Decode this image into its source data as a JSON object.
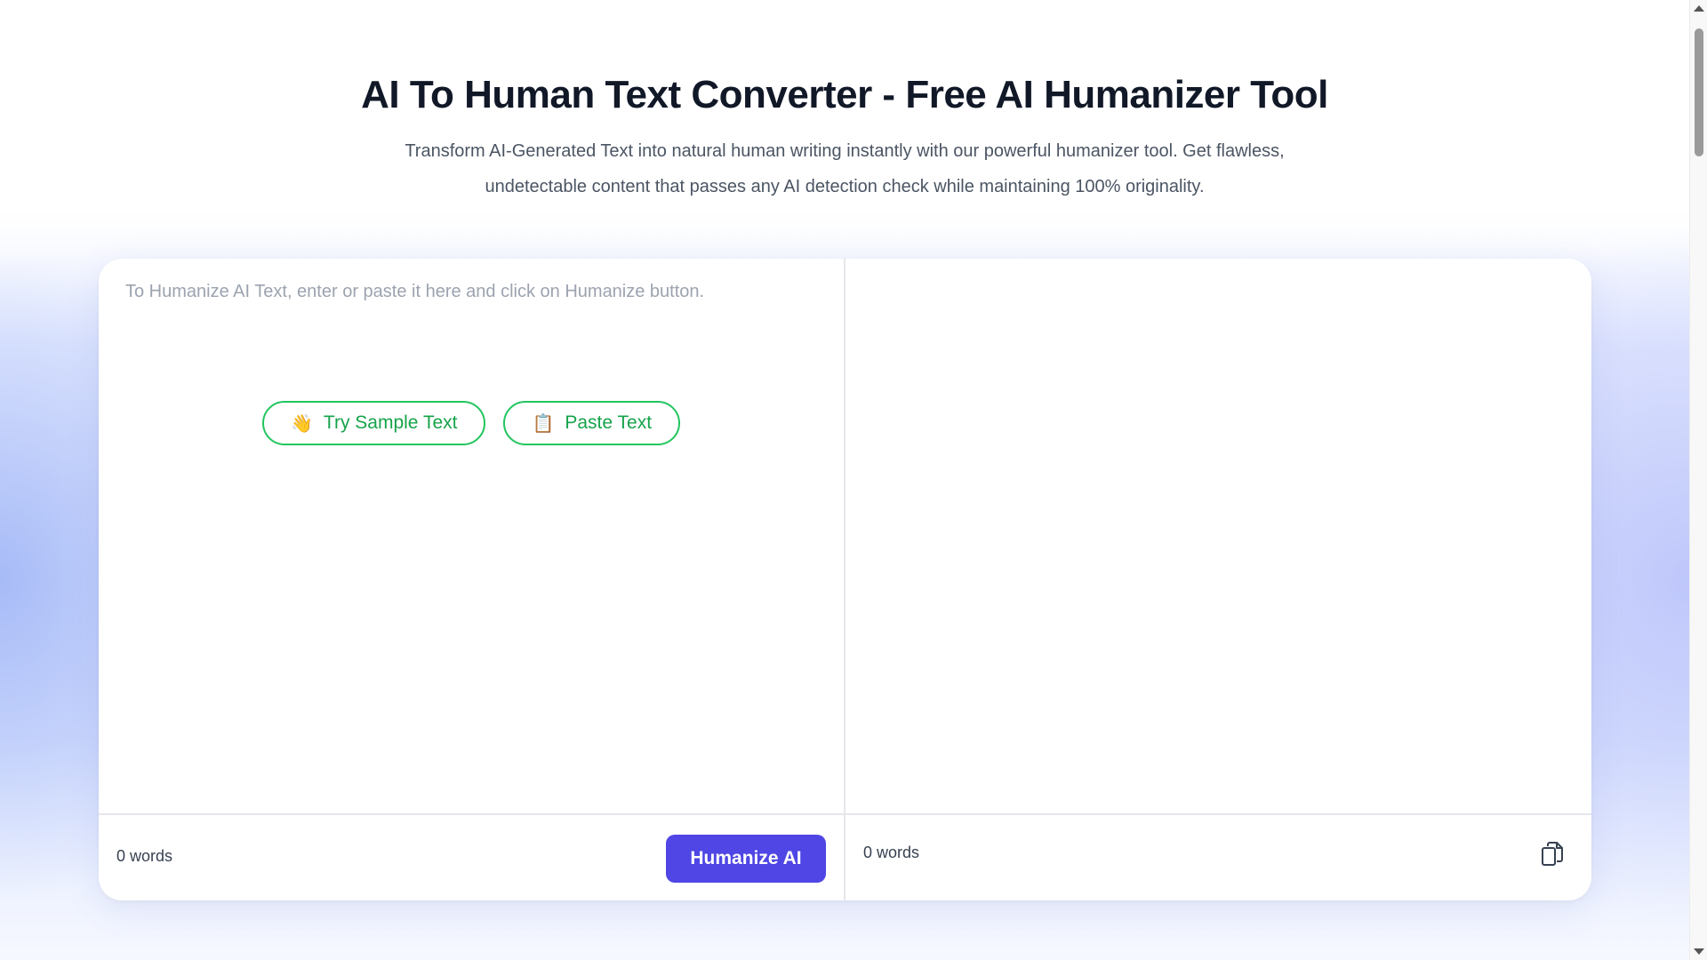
{
  "hero": {
    "title": "AI To Human Text Converter - Free AI Humanizer Tool",
    "subtitle": "Transform AI-Generated Text into natural human writing instantly with our powerful humanizer tool. Get flawless, undetectable content that passes any AI detection check while maintaining 100% originality."
  },
  "input_pane": {
    "placeholder": "To Humanize AI Text, enter or paste it here and click on Humanize button.",
    "try_sample": {
      "emoji": "👋",
      "label": "Try Sample Text"
    },
    "paste_text": {
      "emoji": "📋",
      "label": "Paste Text"
    },
    "word_count": "0 words",
    "humanize_label": "Humanize AI"
  },
  "output_pane": {
    "word_count": "0 words",
    "copy_icon": "copy-icon"
  },
  "colors": {
    "accent": "#4f46e5",
    "pill_green": "#22c55e",
    "title": "#111827"
  }
}
